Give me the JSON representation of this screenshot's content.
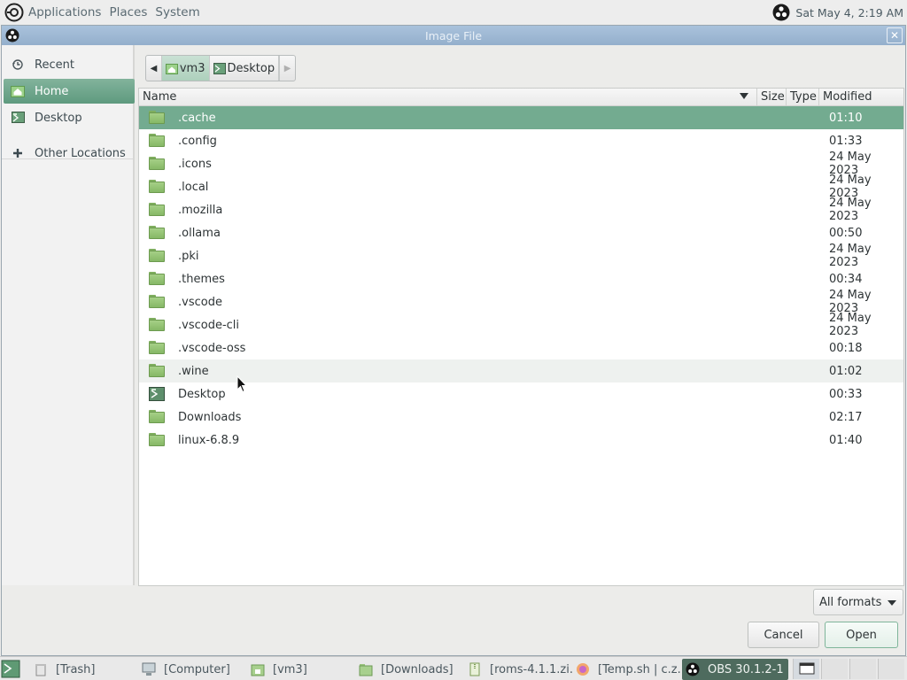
{
  "top_panel": {
    "menus": [
      "Applications",
      "Places",
      "System"
    ],
    "clock": "Sat May  4,  2:19 AM"
  },
  "dialog": {
    "title": "Image File",
    "close_glyph": "✕"
  },
  "sidebar": {
    "items": [
      {
        "label": "Recent",
        "icon": "clock-icon"
      },
      {
        "label": "Home",
        "icon": "home-icon"
      },
      {
        "label": "Desktop",
        "icon": "desktop-icon"
      },
      {
        "label": "Other Locations",
        "icon": "plus-icon"
      }
    ],
    "active": "Home"
  },
  "pathbar": {
    "crumbs": [
      "vm3",
      "Desktop"
    ]
  },
  "columns": {
    "name": "Name",
    "size": "Size",
    "type": "Type",
    "modified": "Modified"
  },
  "files": [
    {
      "name": ".cache",
      "modified": "01:10",
      "kind": "folder"
    },
    {
      "name": ".config",
      "modified": "01:33",
      "kind": "folder"
    },
    {
      "name": ".icons",
      "modified": "24 May 2023",
      "kind": "folder"
    },
    {
      "name": ".local",
      "modified": "24 May 2023",
      "kind": "folder"
    },
    {
      "name": ".mozilla",
      "modified": "24 May 2023",
      "kind": "folder"
    },
    {
      "name": ".ollama",
      "modified": "00:50",
      "kind": "folder"
    },
    {
      "name": ".pki",
      "modified": "24 May 2023",
      "kind": "folder"
    },
    {
      "name": ".themes",
      "modified": "00:34",
      "kind": "folder"
    },
    {
      "name": ".vscode",
      "modified": "24 May 2023",
      "kind": "folder"
    },
    {
      "name": ".vscode-cli",
      "modified": "24 May 2023",
      "kind": "folder"
    },
    {
      "name": ".vscode-oss",
      "modified": "00:18",
      "kind": "folder"
    },
    {
      "name": ".wine",
      "modified": "01:02",
      "kind": "folder"
    },
    {
      "name": "Desktop",
      "modified": "00:33",
      "kind": "desktop"
    },
    {
      "name": "Downloads",
      "modified": "02:17",
      "kind": "folder"
    },
    {
      "name": "linux-6.8.9",
      "modified": "01:40",
      "kind": "folder"
    }
  ],
  "selected_file": ".cache",
  "hovered_file": ".wine",
  "filter": {
    "selected": "All formats"
  },
  "buttons": {
    "cancel": "Cancel",
    "open": "Open"
  },
  "taskbar": {
    "tasks": [
      {
        "label": "[Trash]",
        "icon": "trash-icon"
      },
      {
        "label": "[Computer]",
        "icon": "computer-icon"
      },
      {
        "label": "[vm3]",
        "icon": "home-folder-icon"
      },
      {
        "label": "[Downloads]",
        "icon": "folder-icon"
      },
      {
        "label": "[roms-4.1.1.zi...",
        "icon": "archive-icon"
      },
      {
        "label": "[Temp.sh | c.z...",
        "icon": "firefox-icon"
      },
      {
        "label": "OBS 30.1.2-1 ...",
        "icon": "obs-icon"
      }
    ],
    "active_task": "OBS 30.1.2-1 ..."
  },
  "colors": {
    "accent": "#73ab90",
    "sidebar_active": "#6aa487",
    "titlebar": "#9fb9d4",
    "folder": "#96c477"
  }
}
